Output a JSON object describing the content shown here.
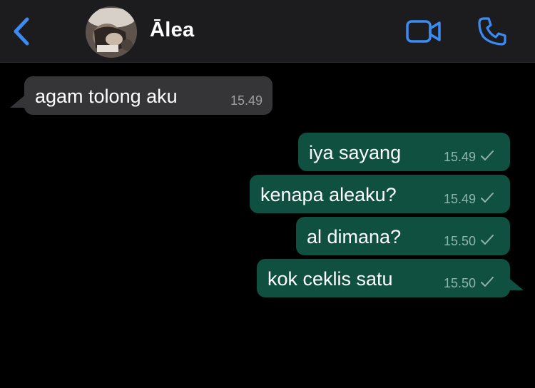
{
  "header": {
    "contact_name": "Ālea",
    "back_icon": "chevron-left-icon",
    "video_icon": "video-camera-icon",
    "call_icon": "phone-icon",
    "accent_color": "#3b8bf2"
  },
  "messages": [
    {
      "direction": "incoming",
      "text": "agam tolong aku",
      "time": "15.49"
    },
    {
      "direction": "outgoing",
      "text": "iya sayang",
      "time": "15.49",
      "status": "sent-single-check"
    },
    {
      "direction": "outgoing",
      "text": "kenapa aleaku?",
      "time": "15.49",
      "status": "sent-single-check"
    },
    {
      "direction": "outgoing",
      "text": "al dimana?",
      "time": "15.50",
      "status": "sent-single-check"
    },
    {
      "direction": "outgoing",
      "text": "kok ceklis satu",
      "time": "15.50",
      "status": "sent-single-check"
    }
  ],
  "colors": {
    "background": "#000000",
    "header_bg": "#1c1c1e",
    "incoming_bubble": "#353537",
    "outgoing_bubble": "#0f5040"
  }
}
